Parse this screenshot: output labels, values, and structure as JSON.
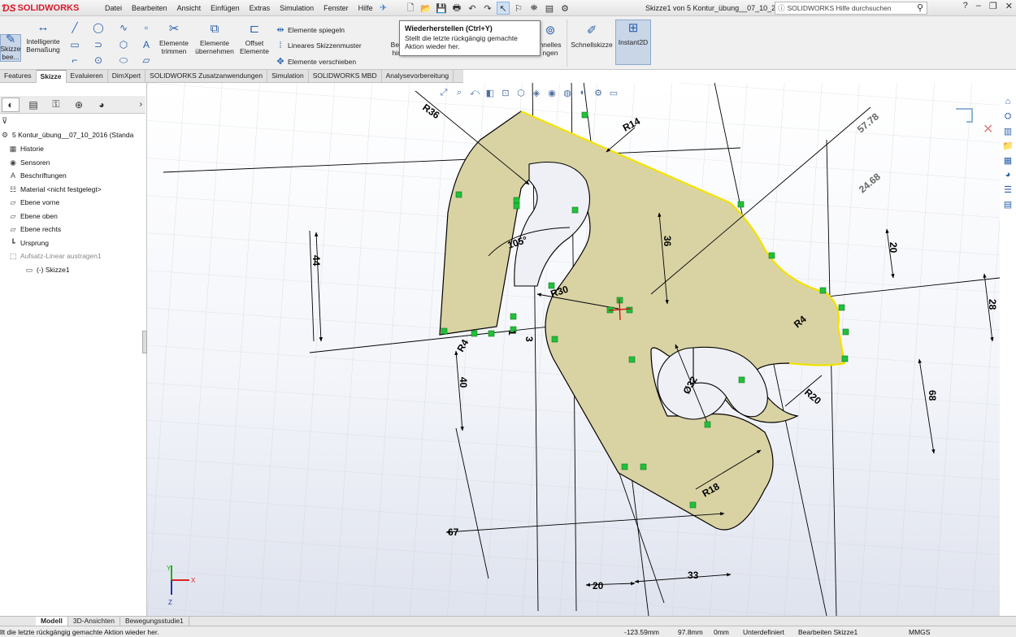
{
  "app": {
    "logo": "SOLIDWORKS",
    "menu": [
      "Datei",
      "Bearbeiten",
      "Ansicht",
      "Einfügen",
      "Extras",
      "Simulation",
      "Fenster",
      "Hilfe"
    ],
    "document_title": "Skizze1 von 5 Kontur_übung__07_10_2...",
    "help_search_placeholder": "SOLIDWORKS Hilfe durchsuchen"
  },
  "tooltip": {
    "title": "Wiederherstellen  (Ctrl+Y)",
    "description": "Stellt die letzte rückgängig gemachte Aktion wieder her."
  },
  "ribbon": {
    "sketch_button": "Skizze bee...",
    "smart_dim": "Intelligente Bemaßung",
    "trim": "Elemente trimmen",
    "convert": "Elemente übernehmen",
    "offset": "Offset Elemente",
    "mirror": "Elemente spiegeln",
    "linear_pattern": "Lineares Skizzenmuster",
    "move": "Elemente verschieben",
    "relations_partial": "Bez hin",
    "repair_partial": "hnelles ngen",
    "quick_sketch": "Schnellskizze",
    "instant2d": "Instant2D"
  },
  "tabs": [
    "Features",
    "Skizze",
    "Evaluieren",
    "DimXpert",
    "SOLIDWORKS Zusatzanwendungen",
    "Simulation",
    "SOLIDWORKS MBD",
    "Analysevorbereitung"
  ],
  "active_tab": "Skizze",
  "tree": {
    "root": "5 Kontur_übung__07_10_2016  (Standa",
    "items": [
      "Historie",
      "Sensoren",
      "Beschriftungen",
      "Material <nicht festgelegt>",
      "Ebene vorne",
      "Ebene oben",
      "Ebene rechts",
      "Ursprung",
      "Aufsatz-Linear austragen1"
    ],
    "child": "(-) Skizze1"
  },
  "dimensions": {
    "r36": "R36",
    "r14": "R14",
    "d57": "57.78",
    "d24": "24.68",
    "a105": "105°",
    "d44": "44",
    "d36": "36",
    "d20a": "20",
    "d28": "28",
    "r30": "R30",
    "r4a": "R4",
    "r4b": "R4",
    "d3": "3",
    "d1": "1",
    "d40": "40",
    "phi32": "Ø32",
    "r20": "R20",
    "d68": "68",
    "r18": "R18",
    "d67": "67",
    "d20b": "20",
    "d33": "33"
  },
  "triad": {
    "x": "X",
    "y": "Y",
    "z": "Z"
  },
  "bottom_tabs": [
    "Modell",
    "3D-Ansichten",
    "Bewegungsstudie1"
  ],
  "active_bottom_tab": "Modell",
  "status": {
    "message": "llt die letzte rückgängig gemachte Aktion wieder her.",
    "x": "-123.59mm",
    "y": "97.8mm",
    "z": "0mm",
    "state": "Unterdefiniert",
    "mode": "Bearbeiten Skizze1",
    "units": "MMGS"
  },
  "colors": {
    "accent": "#d7182a",
    "profile_fill": "#d9d3a4",
    "profile_edge": "#000000",
    "relation_marker": "#22c03a",
    "tab_active": "#ffffff"
  }
}
